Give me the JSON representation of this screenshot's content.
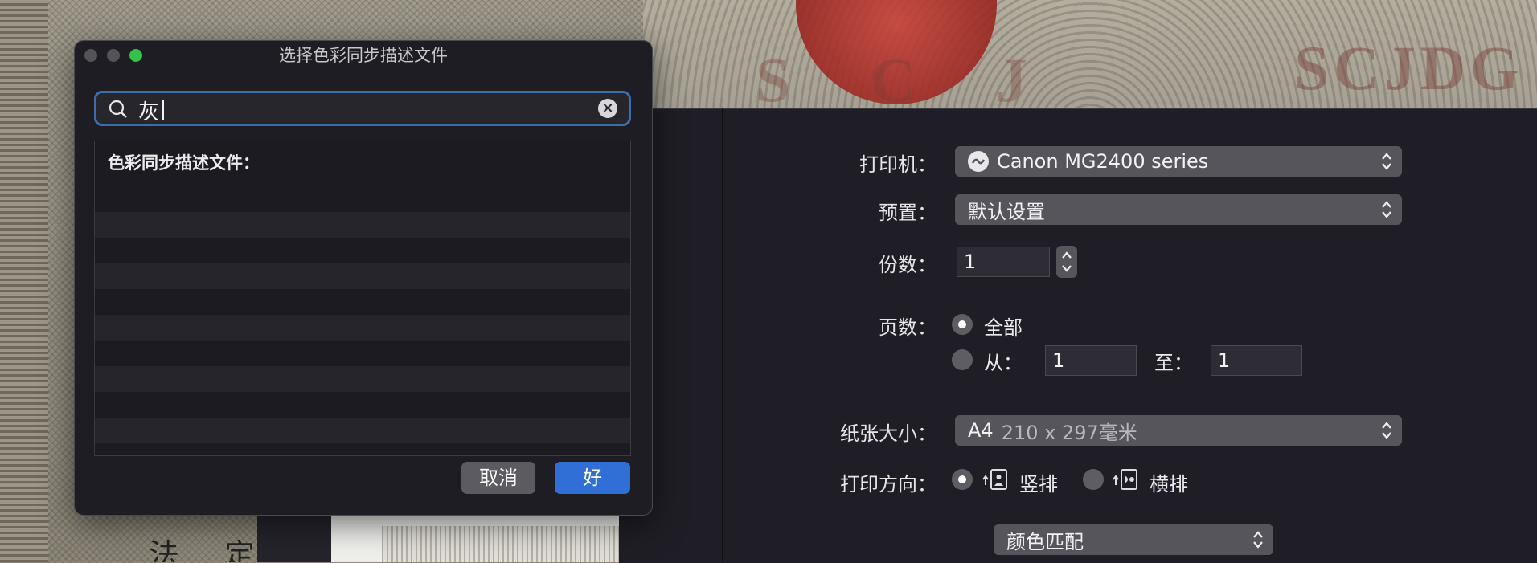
{
  "sheet": {
    "title": "选择色彩同步描述文件",
    "search": {
      "value": "灰"
    },
    "list": {
      "header": "色彩同步描述文件：",
      "rows": 10
    },
    "cancel_label": "取消",
    "ok_label": "好"
  },
  "print": {
    "printer_label": "打印机：",
    "printer_value": "Canon MG2400 series",
    "preset_label": "预置：",
    "preset_value": "默认设置",
    "copies_label": "份数：",
    "copies_value": "1",
    "pages_label": "页数：",
    "pages_all": "全部",
    "pages_from": "从：",
    "pages_from_value": "1",
    "pages_to": "至：",
    "pages_to_value": "1",
    "paper_label": "纸张大小：",
    "paper_value": "A4",
    "paper_dims": "210 x 297毫米",
    "orientation_label": "打印方向：",
    "portrait": "竖排",
    "landscape": "横排",
    "color_match": "颜色匹配"
  },
  "background": {
    "letters_right": "SCJDG",
    "letters_left": "S C J",
    "bottom_text": "法 定 代"
  },
  "colors": {
    "accent": "#2f6fd6",
    "focus_ring": "#3d6ea8"
  }
}
